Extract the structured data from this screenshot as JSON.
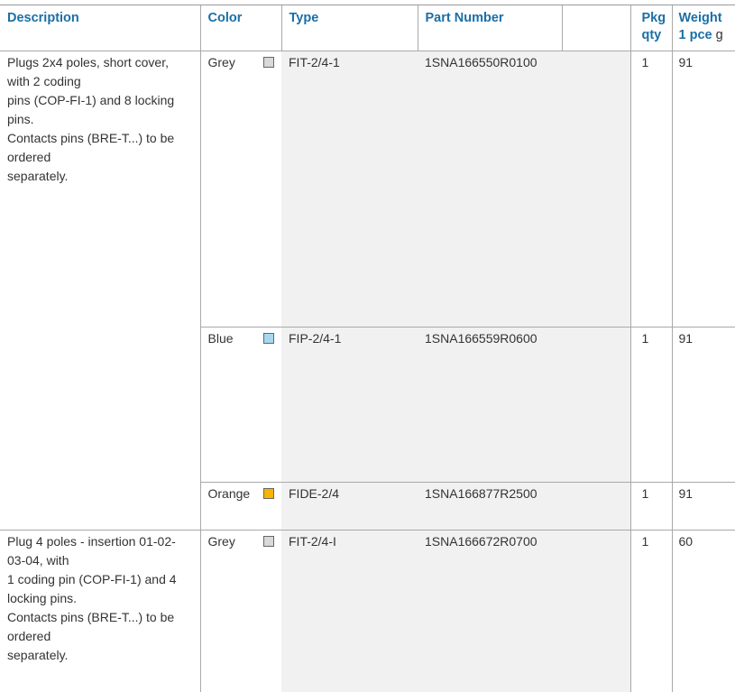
{
  "headers": {
    "description": "Description",
    "color": "Color",
    "type": "Type",
    "part_number": "Part Number",
    "pkg_line1": "Pkg",
    "pkg_line2": "qty",
    "weight_line1": "Weight",
    "weight_line2": "1 pce",
    "weight_unit": "g"
  },
  "groups": [
    {
      "description_lines": [
        "Plugs 2x4 poles, short cover,",
        "with 2 coding",
        "pins (COP-FI-1) and 8 locking",
        "pins.",
        "Contacts pins (BRE-T...) to be",
        "ordered",
        "separately."
      ],
      "rows": [
        {
          "color": "Grey",
          "swatch": "#d9d9d9",
          "type": "FIT-2/4-1",
          "part_number": "1SNA166550R0100",
          "pkg_qty": "1",
          "weight": "91"
        },
        {
          "color": "Blue",
          "swatch": "#a8d8f0",
          "type": "FIP-2/4-1",
          "part_number": "1SNA166559R0600",
          "pkg_qty": "1",
          "weight": "91"
        },
        {
          "color": "Orange",
          "swatch": "#f7b500",
          "type": "FIDE-2/4",
          "part_number": "1SNA166877R2500",
          "pkg_qty": "1",
          "weight": "91"
        }
      ]
    },
    {
      "description_lines": [
        "Plug 4 poles - insertion 01-02-",
        "03-04, with",
        "1 coding pin (COP-FI-1) and 4",
        "locking pins.",
        "Contacts pins (BRE-T...) to be",
        "ordered",
        "separately."
      ],
      "rows": [
        {
          "color": "Grey",
          "swatch": "#d9d9d9",
          "type": "FIT-2/4-I",
          "part_number": "1SNA166672R0700",
          "pkg_qty": "1",
          "weight": "60"
        }
      ]
    }
  ]
}
